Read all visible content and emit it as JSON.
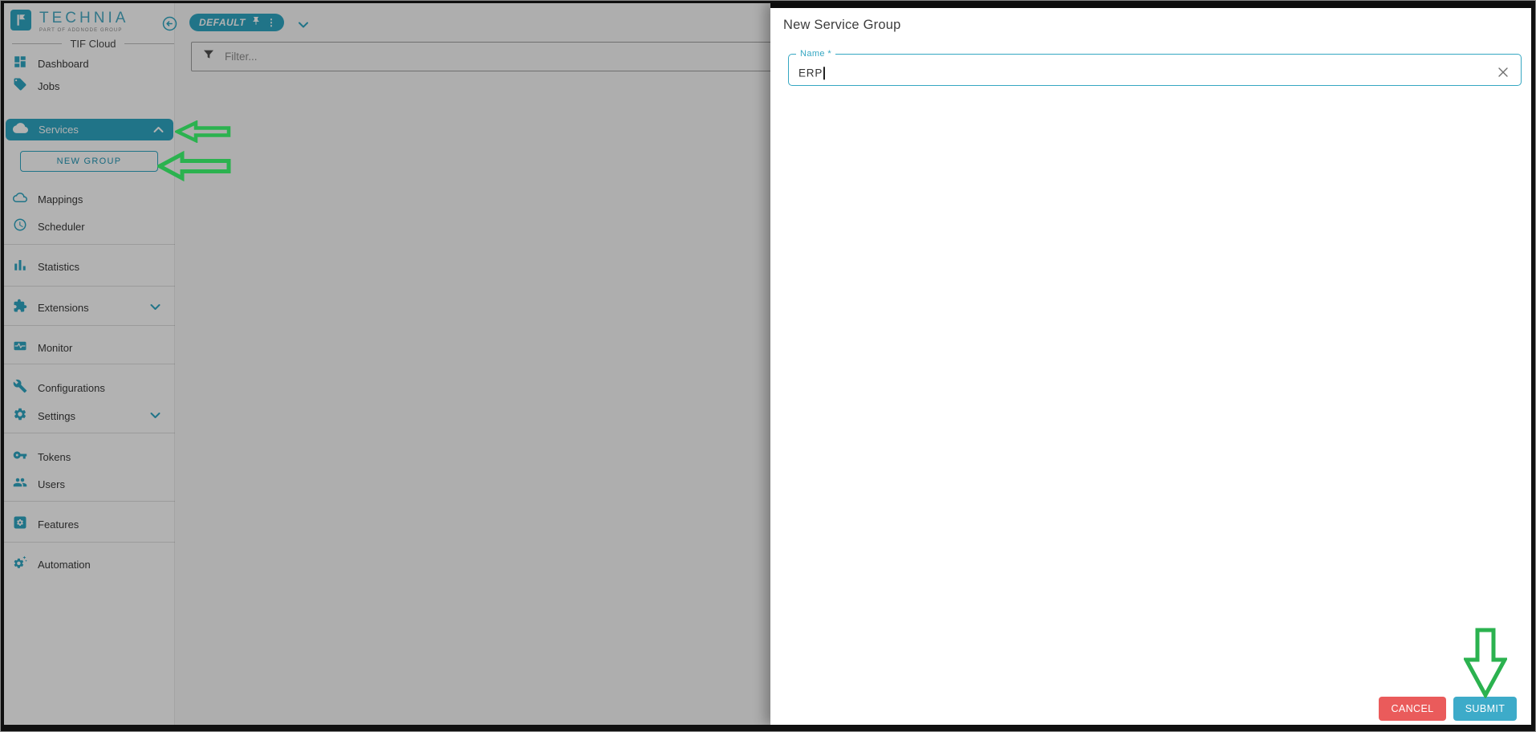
{
  "colors": {
    "accent_teal": "#2FA7C3",
    "submit_teal": "#3DABC9",
    "cancel_red": "#EA5B5B",
    "annotation_green": "#2BB24F"
  },
  "branding": {
    "logo": "TECHNIA",
    "logo_tagline": "PART OF ADDNODE GROUP",
    "product_name": "TIF Cloud"
  },
  "topbar": {
    "environment_badge": "DEFAULT",
    "more_dots": "⋮",
    "filter_placeholder": "Filter..."
  },
  "sidebar": {
    "new_group_button": "NEW GROUP",
    "items": [
      {
        "label": "Dashboard",
        "icon": "dashboard-icon"
      },
      {
        "label": "Jobs",
        "icon": "tag-icon"
      },
      {
        "label": "Services",
        "icon": "cloud-icon",
        "state": "expanded-selected"
      },
      {
        "label": "Mappings",
        "icon": "cloud-outline-icon"
      },
      {
        "label": "Scheduler",
        "icon": "clock-icon"
      },
      {
        "label": "Statistics",
        "icon": "bar-chart-icon"
      },
      {
        "label": "Extensions",
        "icon": "puzzle-icon",
        "state": "collapsed"
      },
      {
        "label": "Monitor",
        "icon": "monitor-icon"
      },
      {
        "label": "Configurations",
        "icon": "wrench-icon"
      },
      {
        "label": "Settings",
        "icon": "gear-icon",
        "state": "collapsed"
      },
      {
        "label": "Tokens",
        "icon": "key-icon"
      },
      {
        "label": "Users",
        "icon": "users-icon"
      },
      {
        "label": "Features",
        "icon": "features-icon"
      },
      {
        "label": "Automation",
        "icon": "automation-icon"
      }
    ]
  },
  "drawer": {
    "title": "New Service Group",
    "name_field": {
      "label": "Name *",
      "value": "ERP"
    },
    "cancel_button": "CANCEL",
    "submit_button": "SUBMIT"
  }
}
